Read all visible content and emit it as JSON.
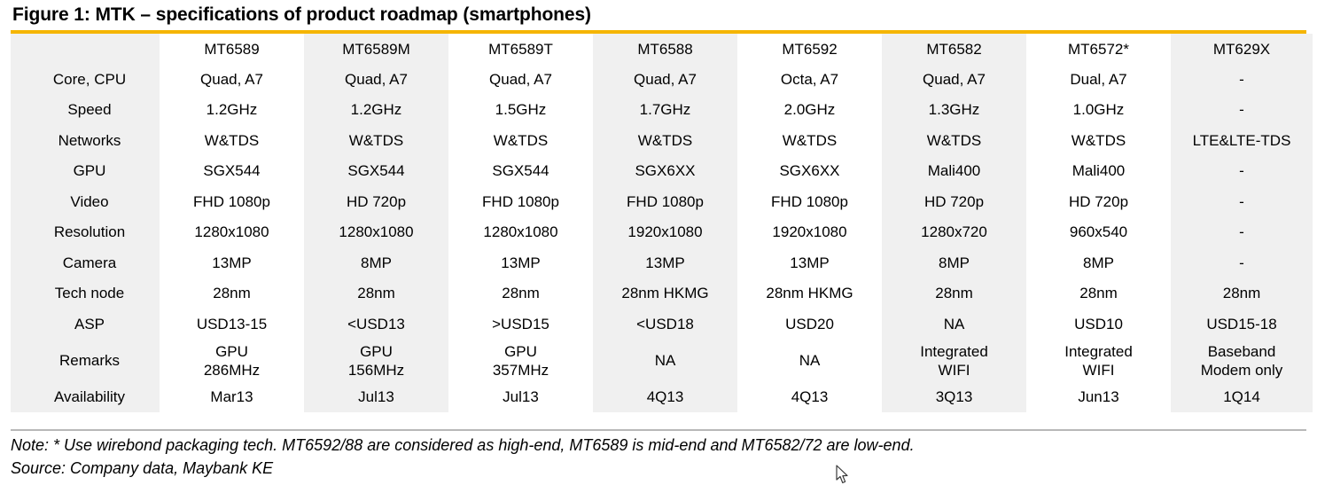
{
  "figure": {
    "title": "Figure 1: MTK – specifications of product roadmap (smartphones)",
    "accent_color": "#f5b500",
    "shade_color": "#f0f0f0",
    "note": "Note: * Use wirebond packaging tech. MT6592/88 are considered as high-end, MT6589 is mid-end and MT6582/72 are low-end.",
    "source": "Source: Company data, Maybank KE"
  },
  "table": {
    "corner_label": "",
    "columns": [
      "MT6589",
      "MT6589M",
      "MT6589T",
      "MT6588",
      "MT6592",
      "MT6582",
      "MT6572*",
      "MT629X"
    ],
    "row_labels": [
      "Core, CPU",
      "Speed",
      "Networks",
      "GPU",
      "Video",
      "Resolution",
      "Camera",
      "Tech node",
      "ASP",
      "Remarks",
      "Availability"
    ],
    "rows": [
      {
        "label": "Core, CPU",
        "values": [
          "Quad, A7",
          "Quad, A7",
          "Quad, A7",
          "Quad, A7",
          "Octa, A7",
          "Quad, A7",
          "Dual, A7",
          "-"
        ]
      },
      {
        "label": "Speed",
        "values": [
          "1.2GHz",
          "1.2GHz",
          "1.5GHz",
          "1.7GHz",
          "2.0GHz",
          "1.3GHz",
          "1.0GHz",
          "-"
        ]
      },
      {
        "label": "Networks",
        "values": [
          "W&TDS",
          "W&TDS",
          "W&TDS",
          "W&TDS",
          "W&TDS",
          "W&TDS",
          "W&TDS",
          "LTE&LTE-TDS"
        ]
      },
      {
        "label": "GPU",
        "values": [
          "SGX544",
          "SGX544",
          "SGX544",
          "SGX6XX",
          "SGX6XX",
          "Mali400",
          "Mali400",
          "-"
        ]
      },
      {
        "label": "Video",
        "values": [
          "FHD 1080p",
          "HD 720p",
          "FHD 1080p",
          "FHD 1080p",
          "FHD 1080p",
          "HD 720p",
          "HD 720p",
          "-"
        ]
      },
      {
        "label": "Resolution",
        "values": [
          "1280x1080",
          "1280x1080",
          "1280x1080",
          "1920x1080",
          "1920x1080",
          "1280x720",
          "960x540",
          "-"
        ]
      },
      {
        "label": "Camera",
        "values": [
          "13MP",
          "8MP",
          "13MP",
          "13MP",
          "13MP",
          "8MP",
          "8MP",
          "-"
        ]
      },
      {
        "label": "Tech node",
        "values": [
          "28nm",
          "28nm",
          "28nm",
          "28nm HKMG",
          "28nm HKMG",
          "28nm",
          "28nm",
          "28nm"
        ]
      },
      {
        "label": "ASP",
        "values": [
          "USD13-15",
          "<USD13",
          ">USD15",
          "<USD18",
          "USD20",
          "NA",
          "USD10",
          "USD15-18"
        ]
      },
      {
        "label": "Remarks",
        "values": [
          "GPU\n286MHz",
          "GPU\n156MHz",
          "GPU\n357MHz",
          "NA",
          "NA",
          "Integrated\nWIFI",
          "Integrated\nWIFI",
          "Baseband\nModem only"
        ]
      },
      {
        "label": "Availability",
        "values": [
          "Mar13",
          "Jul13",
          "Jul13",
          "4Q13",
          "4Q13",
          "3Q13",
          "Jun13",
          "1Q14"
        ]
      }
    ]
  }
}
